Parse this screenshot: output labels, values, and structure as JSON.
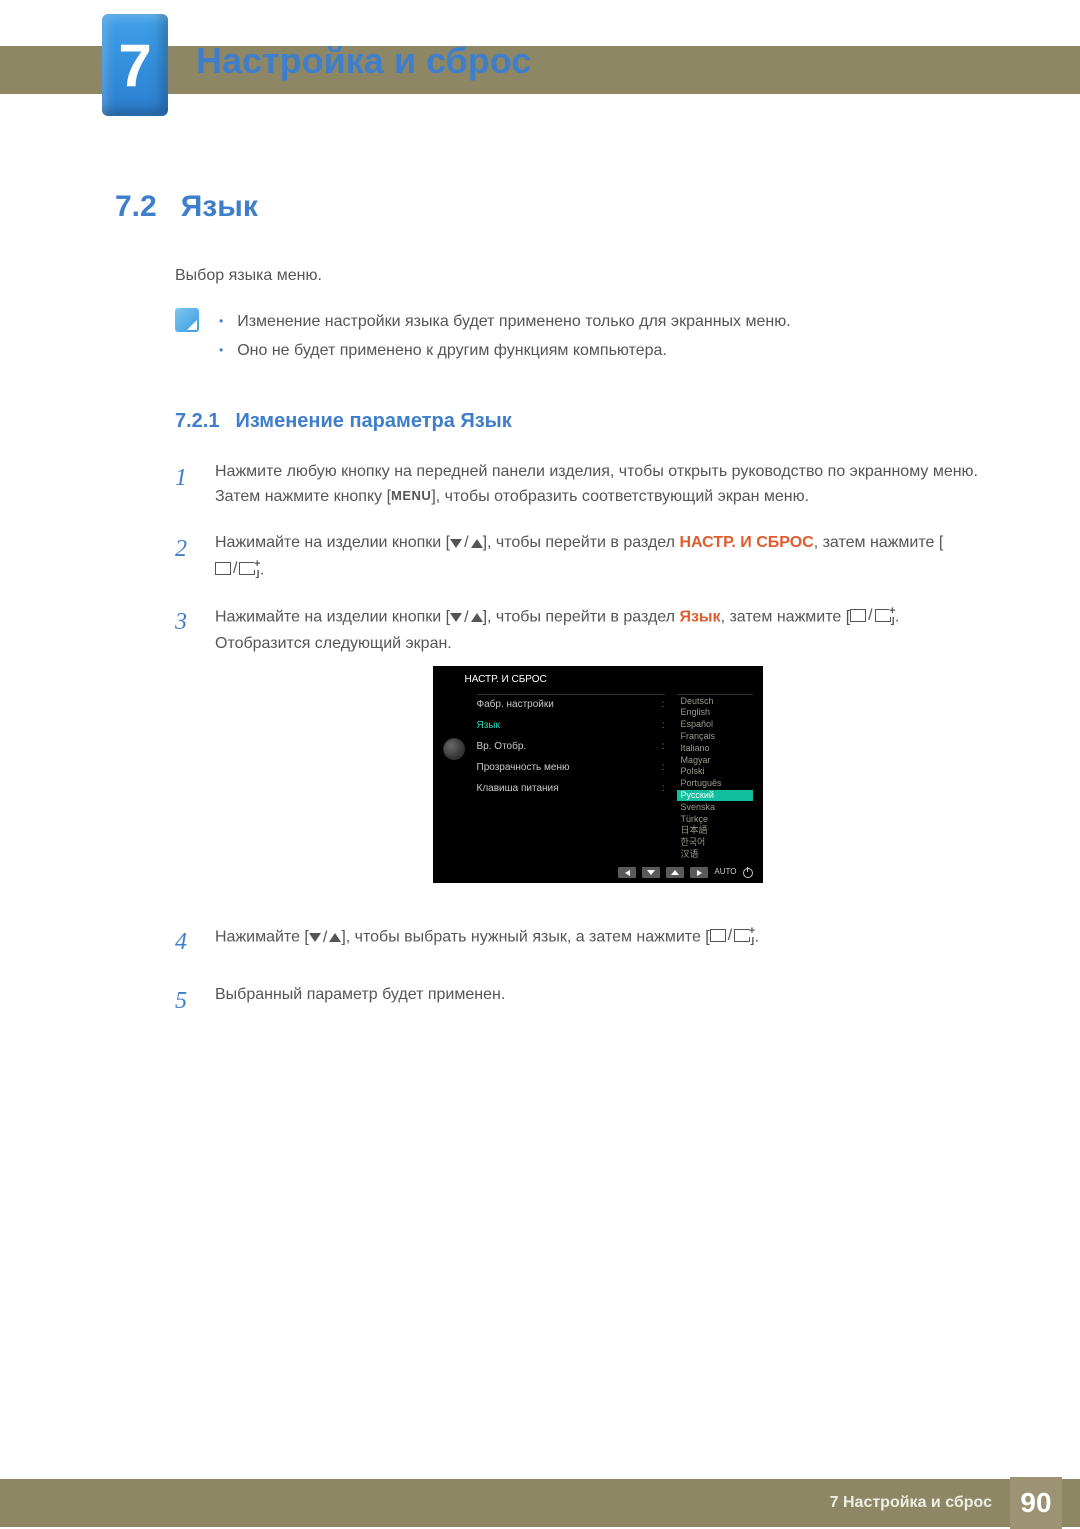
{
  "chapter": {
    "number": "7",
    "title": "Настройка и сброс"
  },
  "section": {
    "number": "7.2",
    "title": "Язык",
    "intro": "Выбор языка меню."
  },
  "notes": [
    "Изменение настройки языка будет применено только для экранных меню.",
    "Оно не будет применено к другим функциям компьютера."
  ],
  "subsection": {
    "number": "7.2.1",
    "title": "Изменение параметра Язык"
  },
  "steps": {
    "s1a": "Нажмите любую кнопку на передней панели изделия, чтобы открыть руководство по экранному меню. Затем нажмите кнопку [",
    "s1_menu": "MENU",
    "s1b": "], чтобы отобразить соответствующий экран меню.",
    "s2a": "Нажимайте на изделии кнопки [",
    "s2b": "], чтобы перейти в раздел ",
    "s2_section": "НАСТР. И СБРОС",
    "s2c": ", затем нажмите [",
    "s2d": "].",
    "s3a": "Нажимайте на изделии кнопки [",
    "s3b": "], чтобы перейти в раздел ",
    "s3_section": "Язык",
    "s3c": ", затем нажмите [",
    "s3d": "]. Отобразится следующий экран.",
    "s4a": "Нажимайте [",
    "s4b": "], чтобы выбрать нужный язык, а затем нажмите [",
    "s4c": "].",
    "s5": "Выбранный параметр будет применен."
  },
  "step_nums": {
    "s1": "1",
    "s2": "2",
    "s3": "3",
    "s4": "4",
    "s5": "5"
  },
  "osd": {
    "title": "НАСТР. И СБРОС",
    "left": [
      {
        "label": "Фабр. настройки",
        "active": false
      },
      {
        "label": "Язык",
        "active": true
      },
      {
        "label": "Вр. Отобр.",
        "active": false
      },
      {
        "label": "Прозрачность меню",
        "active": false
      },
      {
        "label": "Клавиша питания",
        "active": false
      }
    ],
    "languages": [
      "Deutsch",
      "English",
      "Español",
      "Français",
      "Italiano",
      "Magyar",
      "Polski",
      "Português",
      "Русский",
      "Svenska",
      "Türkçe",
      "日本語",
      "한국어",
      "汉语"
    ],
    "selected_language_index": 8,
    "auto_label": "AUTO"
  },
  "footer": {
    "text": "7 Настройка и сброс",
    "page": "90"
  }
}
